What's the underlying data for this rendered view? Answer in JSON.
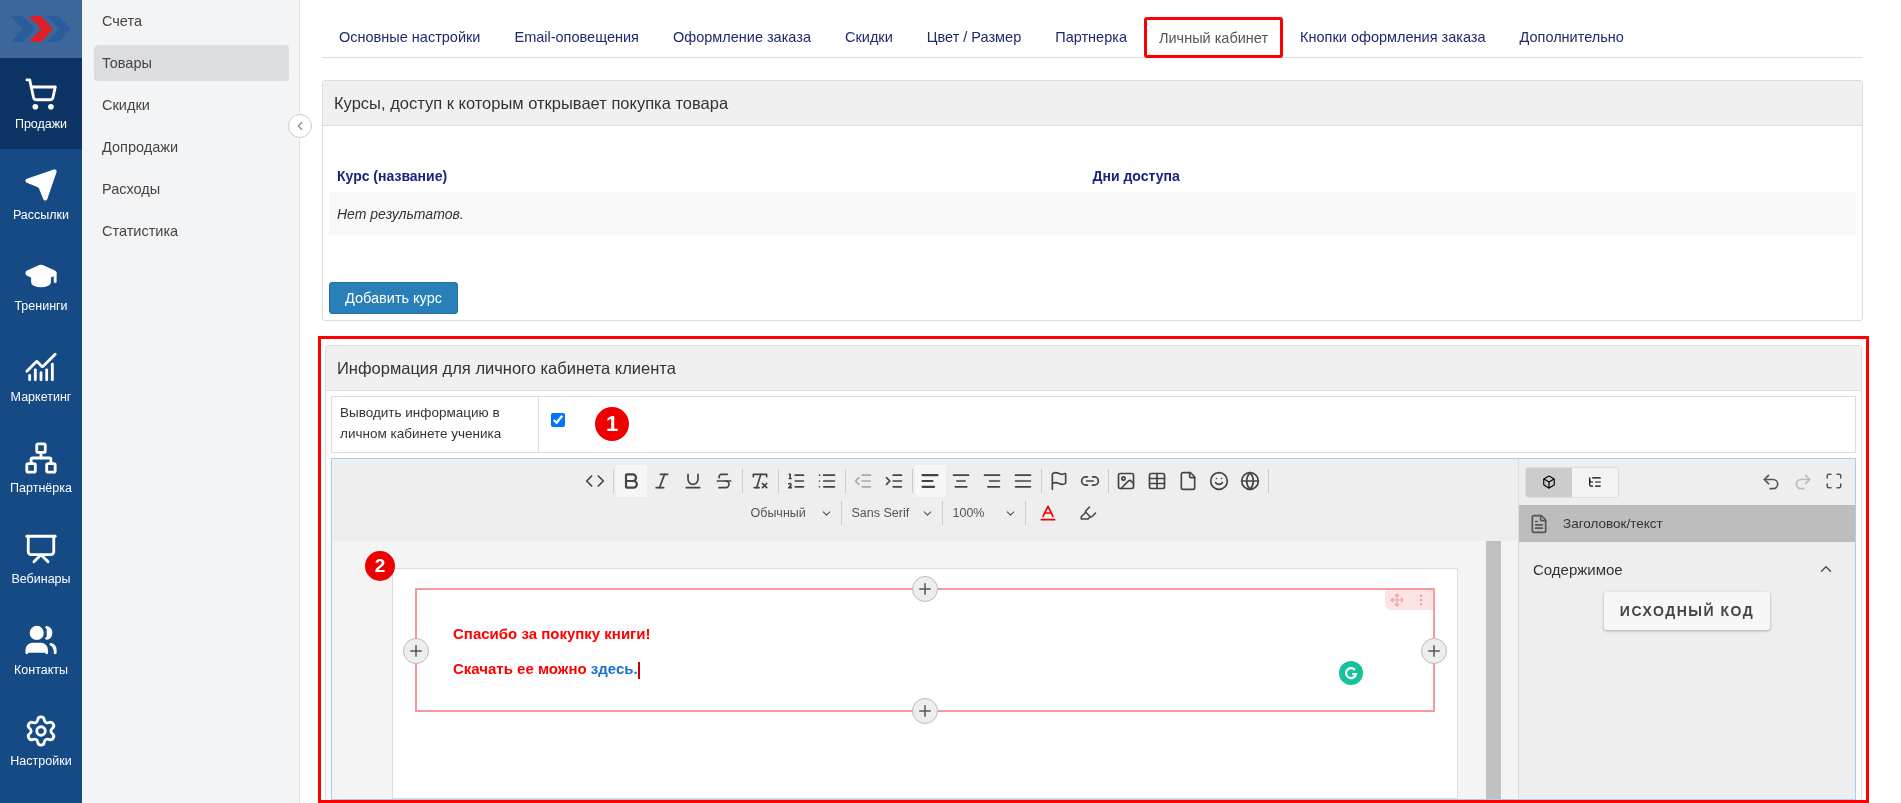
{
  "nav": [
    {
      "label": "Продажи",
      "selected": true
    },
    {
      "label": "Рассылки",
      "selected": false
    },
    {
      "label": "Тренинги",
      "selected": false
    },
    {
      "label": "Маркетинг",
      "selected": false
    },
    {
      "label": "Партнёрка",
      "selected": false
    },
    {
      "label": "Вебинары",
      "selected": false
    },
    {
      "label": "Контакты",
      "selected": false
    },
    {
      "label": "Настройки",
      "selected": false
    }
  ],
  "submenu": [
    {
      "label": "Счета",
      "selected": false
    },
    {
      "label": "Товары",
      "selected": true
    },
    {
      "label": "Скидки",
      "selected": false
    },
    {
      "label": "Допродажи",
      "selected": false
    },
    {
      "label": "Расходы",
      "selected": false
    },
    {
      "label": "Статистика",
      "selected": false
    }
  ],
  "tabs": [
    {
      "label": "Основные настройки",
      "selected": false,
      "highlighted": false
    },
    {
      "label": "Email-оповещения",
      "selected": false,
      "highlighted": false
    },
    {
      "label": "Оформление заказа",
      "selected": false,
      "highlighted": false
    },
    {
      "label": "Скидки",
      "selected": false,
      "highlighted": false
    },
    {
      "label": "Цвет / Размер",
      "selected": false,
      "highlighted": false
    },
    {
      "label": "Партнерка",
      "selected": false,
      "highlighted": false
    },
    {
      "label": "Личный кабинет",
      "selected": true,
      "highlighted": true
    },
    {
      "label": "Кнопки оформления заказа",
      "selected": false,
      "highlighted": false
    },
    {
      "label": "Дополнительно",
      "selected": false,
      "highlighted": false
    }
  ],
  "courses_panel": {
    "title": "Курсы, доступ к которым открывает покупка товара",
    "columns": [
      "Курс (название)",
      "Дни доступа"
    ],
    "empty_text": "Нет результатов.",
    "add_button": "Добавить курс"
  },
  "info_panel": {
    "title": "Информация для личного кабинета клиента",
    "highlighted": true,
    "show_label": "Выводить информацию в личном кабинете ученика",
    "show_checked": true,
    "badge": "1",
    "editor": {
      "format": "Обычный",
      "font": "Sans Serif",
      "size": "100%",
      "views": [
        {
          "selected": true
        },
        {
          "selected": false
        }
      ],
      "block_label": "Заголовок/текст",
      "section": "Содержимое",
      "source_button": "ИСХОДНЫЙ КОД",
      "badge": "2",
      "line1": "Спасибо за покупку книги!",
      "line2": "Скачать ее можно",
      "link": "здесь."
    }
  }
}
